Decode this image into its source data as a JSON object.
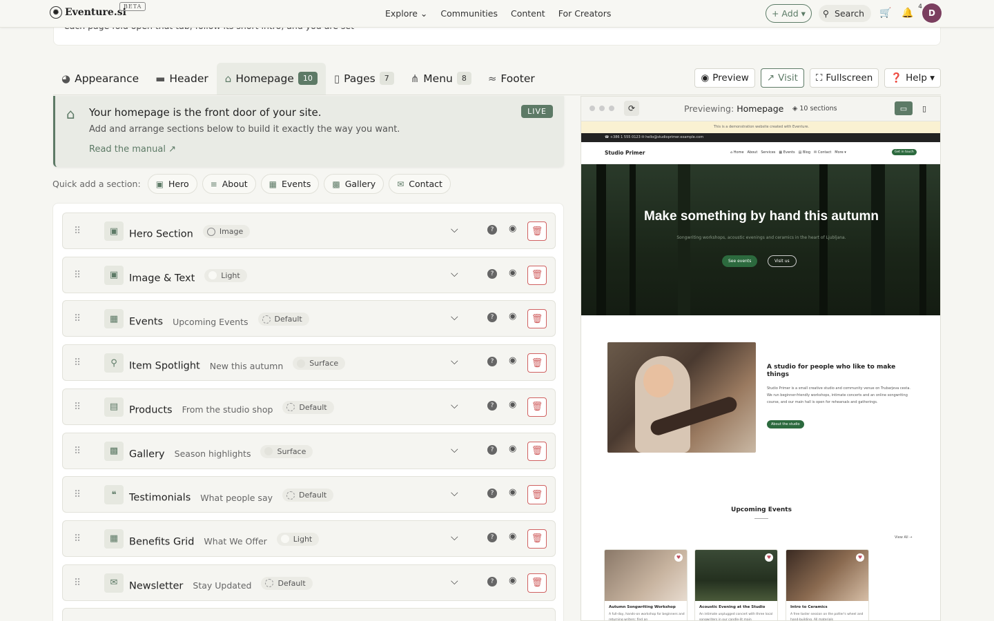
{
  "topnav": {
    "brand": "Eventure.si",
    "beta": "BETA",
    "links": [
      "Explore ⌄",
      "Communities",
      "Content",
      "For Creators"
    ],
    "add": "+ Add ▾",
    "search": "Search",
    "notif_count": "4",
    "avatar": "D"
  },
  "intro_text": "each page fold open that tab, follow its short intro, and you are set",
  "tabs": [
    {
      "icon": "◕",
      "label": "Appearance",
      "count": ""
    },
    {
      "icon": "▬",
      "label": "Header",
      "count": ""
    },
    {
      "icon": "⌂",
      "label": "Homepage",
      "count": "10"
    },
    {
      "icon": "▯",
      "label": "Pages",
      "count": "7"
    },
    {
      "icon": "⋔",
      "label": "Menu",
      "count": "8"
    },
    {
      "icon": "≈",
      "label": "Footer",
      "count": ""
    }
  ],
  "tools": {
    "preview": "Preview",
    "visit": "Visit",
    "fullscreen": "Fullscreen",
    "help": "Help ▾"
  },
  "info": {
    "title": "Your homepage is the front door of your site.",
    "text": "Add and arrange sections below to build it exactly the way you want.",
    "link": "Read the manual ↗",
    "live": "LIVE"
  },
  "quick_add": {
    "label": "Quick add a section:",
    "items": [
      "Hero",
      "About",
      "Events",
      "Gallery",
      "Contact"
    ]
  },
  "sections": [
    {
      "icon": "▣",
      "title": "Hero Section",
      "subtitle": "",
      "style": "Image"
    },
    {
      "icon": "▣",
      "title": "Image & Text",
      "subtitle": "",
      "style": "Light"
    },
    {
      "icon": "▦",
      "title": "Events",
      "subtitle": "Upcoming Events",
      "style": "Default"
    },
    {
      "icon": "⚲",
      "title": "Item Spotlight",
      "subtitle": "New this autumn",
      "style": "Surface"
    },
    {
      "icon": "▤",
      "title": "Products",
      "subtitle": "From the studio shop",
      "style": "Default"
    },
    {
      "icon": "▩",
      "title": "Gallery",
      "subtitle": "Season highlights",
      "style": "Surface"
    },
    {
      "icon": "❝",
      "title": "Testimonials",
      "subtitle": "What people say",
      "style": "Default"
    },
    {
      "icon": "▦",
      "title": "Benefits Grid",
      "subtitle": "What We Offer",
      "style": "Light"
    },
    {
      "icon": "✉",
      "title": "Newsletter",
      "subtitle": "Stay Updated",
      "style": "Default"
    }
  ],
  "preview": {
    "label_prefix": "Previewing:",
    "label_page": "Homepage",
    "sections": "10 sections",
    "site": {
      "demo_banner": "This is a demonstration website created with Eventure.",
      "topbar": "☎ +386 1 555 0123  ✉ hello@studioprimer.example.com",
      "brand": "Studio Primer",
      "links": [
        "⌂ Home",
        "About",
        "Services",
        "▦ Events",
        "▤ Blog",
        "✉ Contact",
        "More ▾"
      ],
      "cta": "Get in touch",
      "hero_title": "Make something by hand this autumn",
      "hero_text": "Songwriting workshops, acoustic evenings and ceramics in the heart of Ljubljana.",
      "hero_btn1": "See events",
      "hero_btn2": "Visit us",
      "about_title": "A studio for people who like to make things",
      "about_text": "Studio Primer is a small creative studio and community venue on Trubarjeva cesta. We run beginner-friendly workshops, intimate concerts and an online songwriting course, and our main hall is open for rehearsals and gatherings.",
      "about_btn": "About the studio",
      "events_title": "Upcoming Events",
      "view_all": "View All →",
      "cards": [
        {
          "title": "Autumn Songwriting Workshop",
          "desc": "A full-day, hands-on workshop for beginners and returning writers: find an"
        },
        {
          "title": "Acoustic Evening at the Studio",
          "desc": "An intimate unplugged concert with three local songwriters in our candle-lit main"
        },
        {
          "title": "Intro to Ceramics",
          "desc": "A free taster session on the potter's wheel and hand-building. All materials"
        }
      ]
    }
  }
}
